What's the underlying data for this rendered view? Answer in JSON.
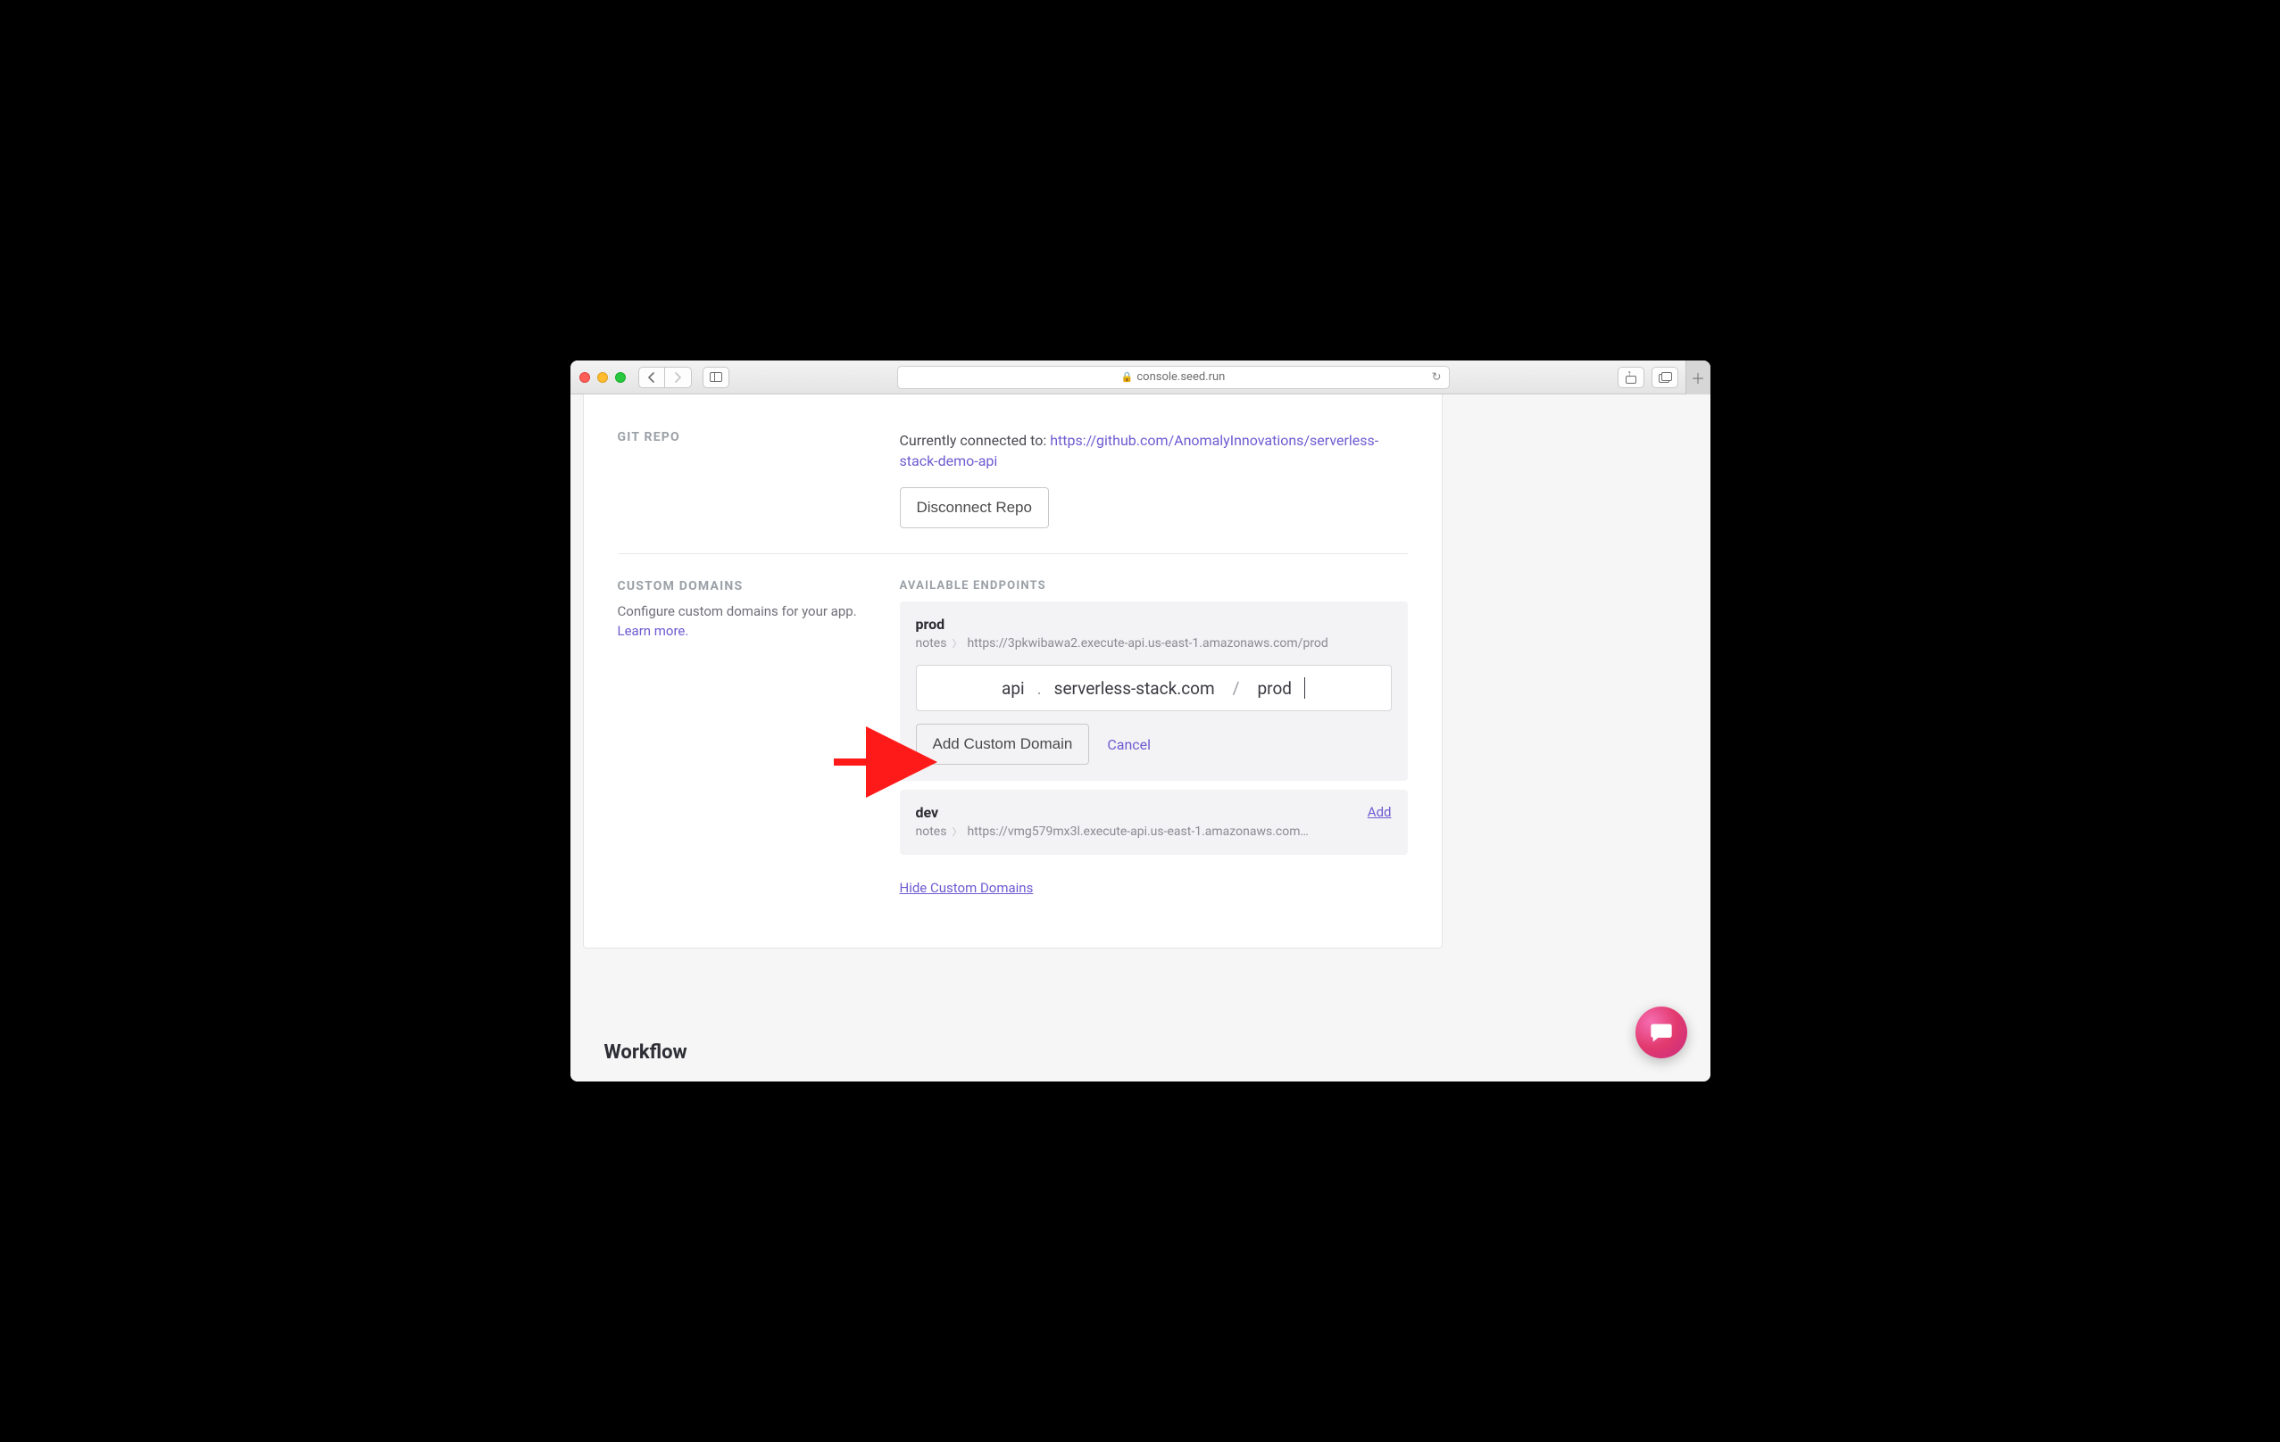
{
  "browser": {
    "url_display": "console.seed.run"
  },
  "git_repo": {
    "title": "GIT REPO",
    "connected_label": "Currently connected to: ",
    "connected_url": "https://github.com/AnomalyInnovations/serverless-stack-demo-api",
    "disconnect_btn": "Disconnect Repo"
  },
  "custom_domains": {
    "title": "CUSTOM DOMAINS",
    "desc_prefix": "Configure custom domains for your app. ",
    "learn_more": "Learn more.",
    "subheader": "AVAILABLE ENDPOINTS",
    "endpoints": [
      {
        "name": "prod",
        "service": "notes",
        "url": "https://3pkwibawa2.execute-api.us-east-1.amazonaws.com/prod",
        "expanded": true,
        "input": {
          "subdomain": "api",
          "domain": "serverless-stack.com",
          "path": "prod"
        },
        "add_btn": "Add Custom Domain",
        "cancel": "Cancel"
      },
      {
        "name": "dev",
        "service": "notes",
        "url": "https://vmg579mx3l.execute-api.us-east-1.amazonaws.com…",
        "expanded": false,
        "add_link": "Add"
      }
    ],
    "hide_link": "Hide Custom Domains"
  },
  "workflow": {
    "heading": "Workflow"
  }
}
